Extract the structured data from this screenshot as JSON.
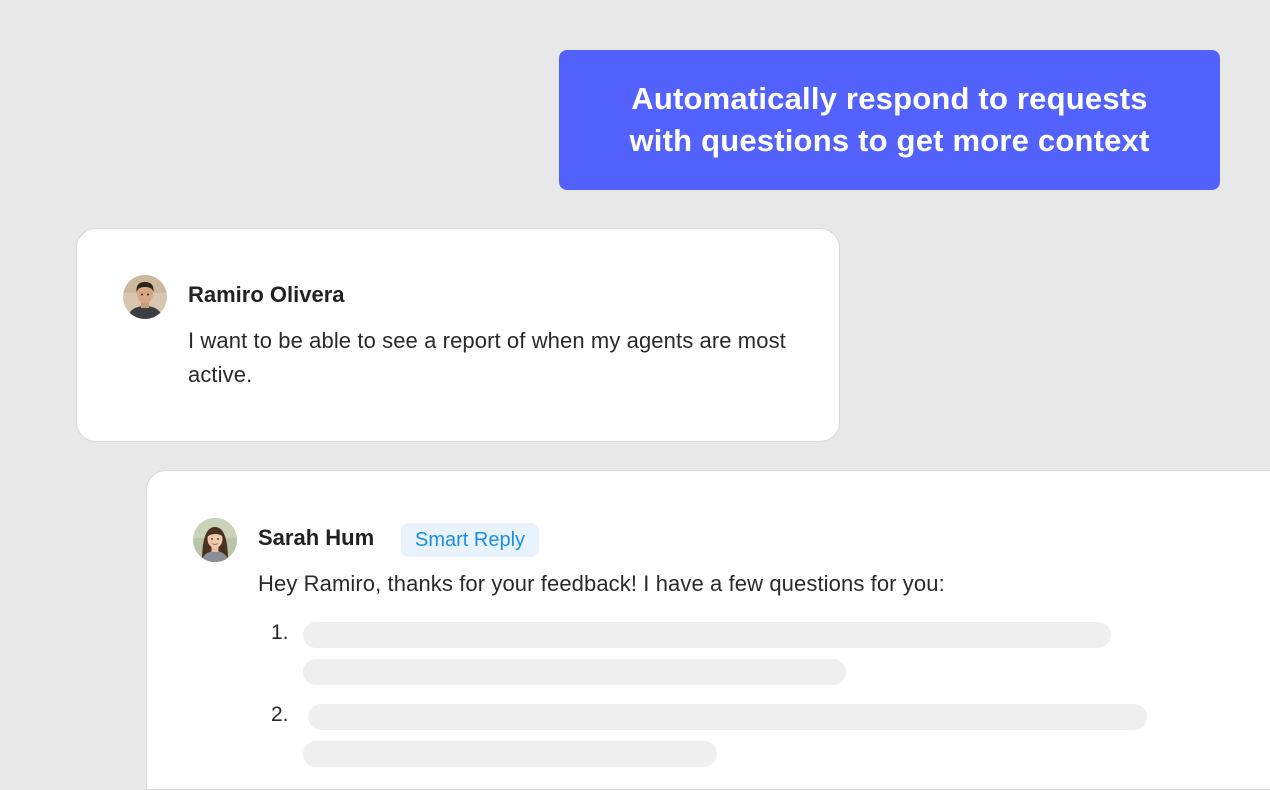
{
  "banner": {
    "text": "Automatically respond to requests with questions to get more context",
    "color": "#5462fd"
  },
  "request_card": {
    "author": "Ramiro Olivera",
    "avatar_icon": "avatar-ramiro",
    "message": "I want to be able to see a report of when my agents are most active."
  },
  "reply_card": {
    "author": "Sarah Hum",
    "avatar_icon": "avatar-sarah",
    "badge": "Smart Reply",
    "badge_color": "#1a8fe0",
    "message": "Hey Ramiro, thanks for your feedback! I have a few questions for you:",
    "list": [
      {
        "number": "1."
      },
      {
        "number": "2."
      }
    ]
  }
}
